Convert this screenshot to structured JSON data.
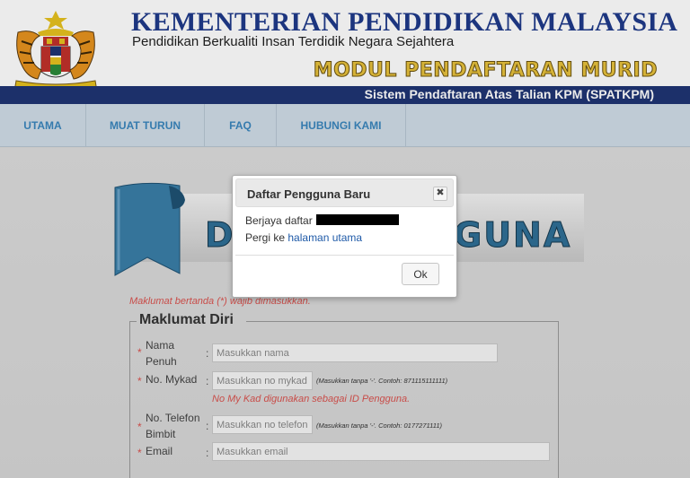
{
  "header": {
    "ministry_name": "KEMENTERIAN PENDIDIKAN MALAYSIA",
    "tagline": "Pendidikan Berkualiti Insan Terdidik Negara Sejahtera",
    "module_title": "MODUL PENDAFTARAN MURID",
    "system_name": "Sistem Pendaftaran Atas Talian KPM (SPATKPM)",
    "brand_blue": "#1f3574",
    "logo": "malaysia-coat-of-arms"
  },
  "nav": {
    "items": [
      {
        "label": "UTAMA"
      },
      {
        "label": "MUAT TURUN"
      },
      {
        "label": "FAQ"
      },
      {
        "label": "HUBUNGI KAMI"
      }
    ]
  },
  "page": {
    "title_left": "DA",
    "title_right": "GUNA"
  },
  "form": {
    "required_note": "Maklumat bertanda (*) wajib dimasukkan.",
    "legend": "Maklumat Diri",
    "fields": {
      "nama": {
        "label_line1": "Nama",
        "label_line2": "Penuh",
        "placeholder": "Masukkan nama"
      },
      "mykad": {
        "label": "No. Mykad",
        "placeholder": "Masukkan no mykad",
        "hint": "(Masukkan tanpa '-'. Contoh: 871115111111)",
        "note": "No My Kad digunakan sebagai ID Pengguna."
      },
      "telefon": {
        "label_line1": "No. Telefon",
        "label_line2": "Bimbit",
        "placeholder": "Masukkan no telefon",
        "hint": "(Masukkan tanpa '-'. Contoh: 0177271111)"
      },
      "email": {
        "label": "Email",
        "placeholder": "Masukkan email"
      }
    }
  },
  "dialog": {
    "title": "Daftar Pengguna Baru",
    "close_symbol": "✖",
    "message_prefix": "Berjaya daftar",
    "goto_prefix": "Pergi ke",
    "goto_link": "halaman utama",
    "ok_label": "Ok"
  }
}
